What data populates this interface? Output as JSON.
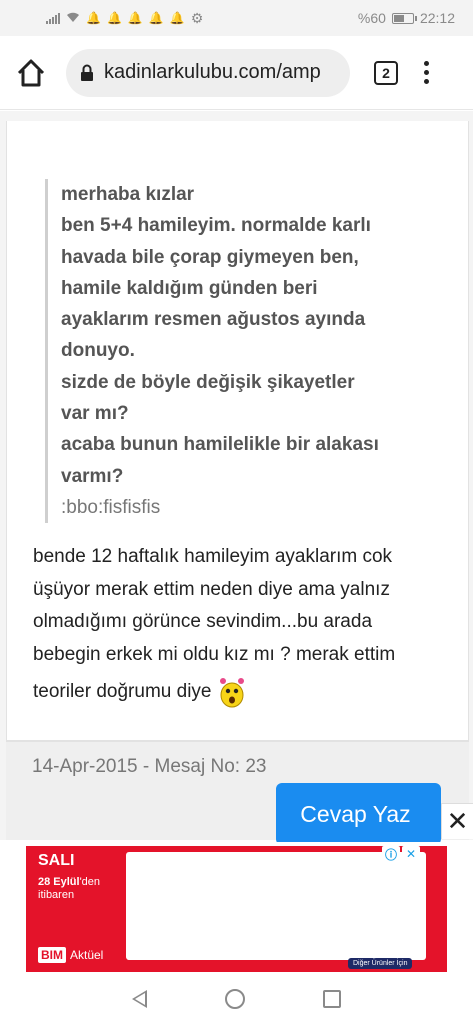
{
  "status_bar": {
    "battery_percent": "%60",
    "battery_level": 0.6,
    "time": "22:12",
    "notification_icons": [
      "bell-icon",
      "bell-icon",
      "bell-icon",
      "bell-icon",
      "bell-icon"
    ]
  },
  "browser": {
    "url": "kadinlarkulubu.com/amp",
    "tab_count": "2"
  },
  "post": {
    "quote_lines": [
      "merhaba kızlar",
      "ben 5+4 hamileyim. normalde karlı",
      "havada bile çorap giymeyen ben,",
      "hamile kaldığım günden beri",
      "ayaklarım resmen ağustos ayında",
      "donuyo.",
      "sizde de böyle değişik şikayetler",
      "var mı?",
      "acaba bunun hamilelikle bir alakası",
      "varmı?"
    ],
    "quote_emoticon_code": ":bbo:fisfisfis",
    "reply_lines": [
      "bende 12 haftalık hamileyim ayaklarım cok",
      "üşüyor merak ettim neden diye ama yalnız",
      "olmadığımı görünce sevindim...bu arada",
      "bebegin erkek mi oldu kız mı ? merak ettim"
    ],
    "reply_last_line": "teoriler doğrumu diye",
    "meta": "14-Apr-2015 - Mesaj No: 23"
  },
  "actions": {
    "reply_button": "Cevap Yaz",
    "close_ad": "✕"
  },
  "ad": {
    "day": "SALI",
    "date_bold": "28 Eylül",
    "date_rest": "'den itibaren",
    "brand": "BIM",
    "brand_suffix": "Aktüel",
    "more_button": "Diğer Ürünler İçin",
    "brand_color": "#e4132a"
  },
  "colors": {
    "accent": "#1a8cf0",
    "quote_border": "#cfcfcf"
  }
}
